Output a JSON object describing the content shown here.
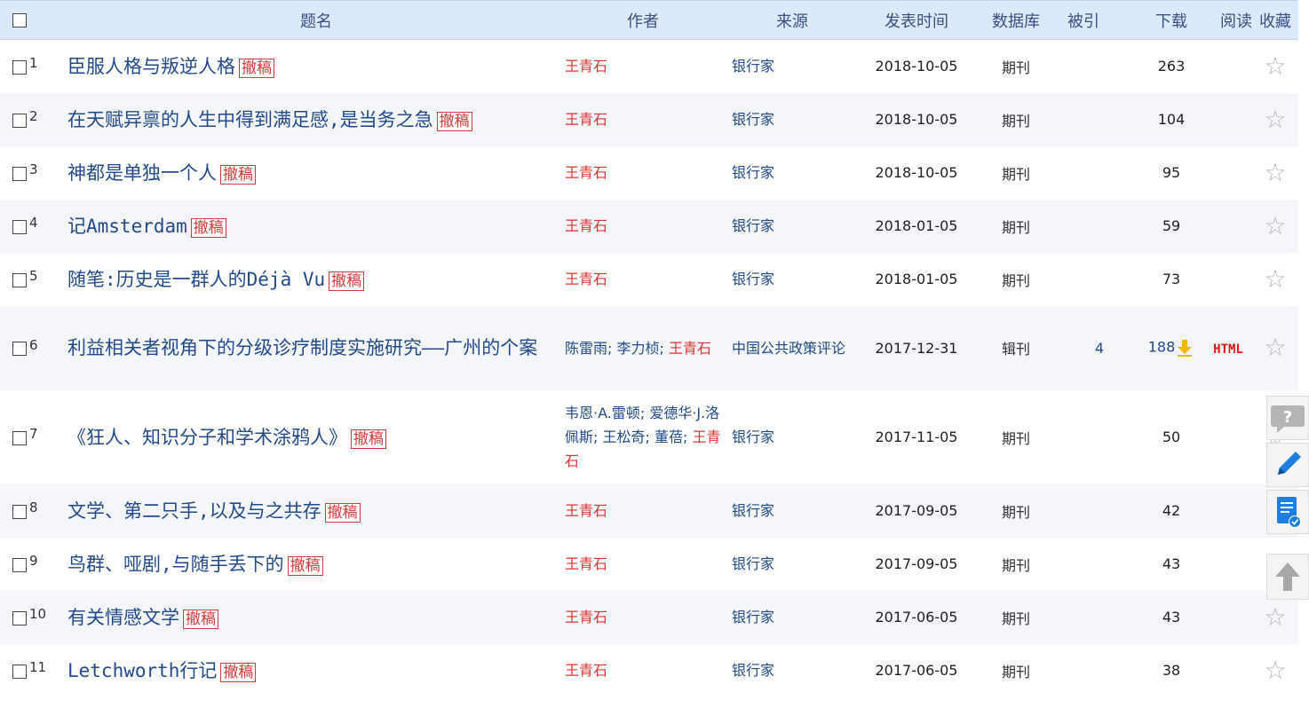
{
  "header": {
    "title": "题名",
    "author": "作者",
    "source": "来源",
    "date": "发表时间",
    "database": "数据库",
    "cited": "被引",
    "downloads": "下载",
    "read": "阅读",
    "favorite": "收藏"
  },
  "retract_label": "撤稿",
  "rows": [
    {
      "n": "1",
      "title": "臣服人格与叛逆人格",
      "retract": true,
      "authors": [
        {
          "name": "王青石",
          "self": true
        }
      ],
      "source": "银行家",
      "date": "2018-10-05",
      "db": "期刊",
      "cited": "",
      "downloads": "263",
      "dl_icon": false,
      "read": ""
    },
    {
      "n": "2",
      "title": "在天赋异禀的人生中得到满足感,是当务之急",
      "retract": true,
      "authors": [
        {
          "name": "王青石",
          "self": true
        }
      ],
      "source": "银行家",
      "date": "2018-10-05",
      "db": "期刊",
      "cited": "",
      "downloads": "104",
      "dl_icon": false,
      "read": ""
    },
    {
      "n": "3",
      "title": "神都是单独一个人",
      "retract": true,
      "authors": [
        {
          "name": "王青石",
          "self": true
        }
      ],
      "source": "银行家",
      "date": "2018-10-05",
      "db": "期刊",
      "cited": "",
      "downloads": "95",
      "dl_icon": false,
      "read": ""
    },
    {
      "n": "4",
      "title": "记Amsterdam",
      "retract": true,
      "authors": [
        {
          "name": "王青石",
          "self": true
        }
      ],
      "source": "银行家",
      "date": "2018-01-05",
      "db": "期刊",
      "cited": "",
      "downloads": "59",
      "dl_icon": false,
      "read": ""
    },
    {
      "n": "5",
      "title": "随笔:历史是一群人的Déjà Vu",
      "retract": true,
      "authors": [
        {
          "name": "王青石",
          "self": true
        }
      ],
      "source": "银行家",
      "date": "2018-01-05",
      "db": "期刊",
      "cited": "",
      "downloads": "73",
      "dl_icon": false,
      "read": ""
    },
    {
      "n": "6",
      "title": "利益相关者视角下的分级诊疗制度实施研究——广州的个案",
      "retract": false,
      "authors": [
        {
          "name": "陈雷雨",
          "self": false
        },
        {
          "name": "李力桢",
          "self": false
        },
        {
          "name": "王青石",
          "self": true
        }
      ],
      "source": "中国公共政策评论",
      "date": "2017-12-31",
      "db": "辑刊",
      "cited": "4",
      "downloads": "188",
      "dl_icon": true,
      "read": "HTML"
    },
    {
      "n": "7",
      "title": "《狂人、知识分子和学术涂鸦人》",
      "retract": true,
      "authors": [
        {
          "name": "韦恩·A.雷顿",
          "self": false
        },
        {
          "name": "爱德华·J.洛佩斯",
          "self": false
        },
        {
          "name": "王松奇",
          "self": false
        },
        {
          "name": "董蓓",
          "self": false
        },
        {
          "name": "王青石",
          "self": true
        }
      ],
      "source": "银行家",
      "date": "2017-11-05",
      "db": "期刊",
      "cited": "",
      "downloads": "50",
      "dl_icon": false,
      "read": ""
    },
    {
      "n": "8",
      "title": "文学、第二只手,以及与之共存",
      "retract": true,
      "authors": [
        {
          "name": "王青石",
          "self": true
        }
      ],
      "source": "银行家",
      "date": "2017-09-05",
      "db": "期刊",
      "cited": "",
      "downloads": "42",
      "dl_icon": false,
      "read": ""
    },
    {
      "n": "9",
      "title": "鸟群、哑剧,与随手丢下的",
      "retract": true,
      "authors": [
        {
          "name": "王青石",
          "self": true
        }
      ],
      "source": "银行家",
      "date": "2017-09-05",
      "db": "期刊",
      "cited": "",
      "downloads": "43",
      "dl_icon": false,
      "read": ""
    },
    {
      "n": "10",
      "title": "有关情感文学",
      "retract": true,
      "authors": [
        {
          "name": "王青石",
          "self": true
        }
      ],
      "source": "银行家",
      "date": "2017-06-05",
      "db": "期刊",
      "cited": "",
      "downloads": "43",
      "dl_icon": false,
      "read": ""
    },
    {
      "n": "11",
      "title": "Letchworth行记",
      "retract": true,
      "authors": [
        {
          "name": "王青石",
          "self": true
        }
      ],
      "source": "银行家",
      "date": "2017-06-05",
      "db": "期刊",
      "cited": "",
      "downloads": "38",
      "dl_icon": false,
      "read": ""
    }
  ],
  "side_tools": [
    {
      "name": "help-tool",
      "icon": "question-bubble-icon"
    },
    {
      "name": "edit-tool",
      "icon": "pencil-icon"
    },
    {
      "name": "list-tool",
      "icon": "document-check-icon"
    },
    {
      "name": "back-to-top-tool",
      "icon": "arrow-up-icon"
    }
  ],
  "colors": {
    "header_bg": "#dbe9fb",
    "title_link": "#234a8c",
    "self_author": "#dd3333",
    "retract_badge": "#d43a3a",
    "html_tag": "#e01414",
    "download_icon": "#f5b400",
    "row_alt_bg": "#f4f6fa"
  }
}
